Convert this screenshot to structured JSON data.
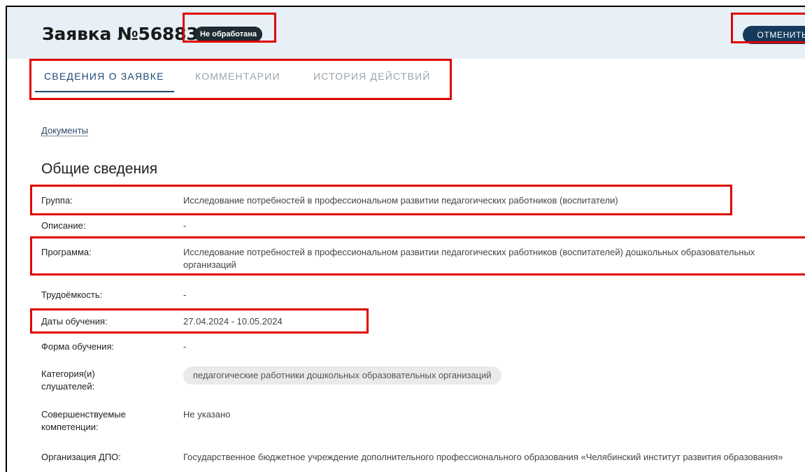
{
  "header": {
    "title": "Заявка №56883",
    "status_badge": "Не обработана",
    "cancel_label": "ОТМЕНИТЬ"
  },
  "tabs": [
    {
      "label": "СВЕДЕНИЯ О ЗАЯВКЕ",
      "active": true
    },
    {
      "label": "КОММЕНТАРИИ",
      "active": false
    },
    {
      "label": "ИСТОРИЯ ДЕЙСТВИЙ",
      "active": false
    }
  ],
  "documents_link": "Документы",
  "section_title": "Общие сведения",
  "fields": {
    "group": {
      "label": "Группа:",
      "value": "Исследование потребностей в профессиональном развитии педагогических работников (воспитатели)"
    },
    "description": {
      "label": "Описание:",
      "value": "-"
    },
    "program": {
      "label": "Программа:",
      "value": "Исследование потребностей в профессиональном развитии педагогических работников (воспитателей) дошкольных образовательных организаций"
    },
    "labor_intensity": {
      "label": "Трудоёмкость:",
      "value": "-"
    },
    "dates": {
      "label": "Даты обучения:",
      "value": "27.04.2024 - 10.05.2024"
    },
    "form": {
      "label": "Форма обучения:",
      "value": "-"
    },
    "categories": {
      "label": "Категория(и) слушателей:",
      "value": "педагогические работники дошкольных образовательных организаций"
    },
    "competencies": {
      "label": "Совершенствуемые компетенции:",
      "value": "Не указано"
    },
    "organization": {
      "label": "Организация ДПО:",
      "value": "Государственное бюджетное учреждение дополнительного профессионального образования «Челябинский институт развития образования»"
    }
  },
  "colors": {
    "header_bg": "#e6f0f6",
    "accent": "#1e4a74",
    "highlight": "#e00000"
  }
}
